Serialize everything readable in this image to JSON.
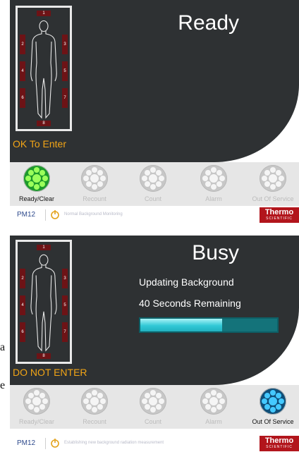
{
  "page_fragments": [
    "a",
    "e"
  ],
  "screens": [
    {
      "state_title": "Ready",
      "entry_status": "OK To Enter",
      "messages": [],
      "progress": null,
      "sensors": [
        "1",
        "2",
        "3",
        "4",
        "5",
        "6",
        "7",
        "8"
      ],
      "indicators": [
        {
          "label": "Ready/Clear",
          "active": true,
          "color": "#1d9a2c"
        },
        {
          "label": "Recount",
          "active": false
        },
        {
          "label": "Count",
          "active": false
        },
        {
          "label": "Alarm",
          "active": false
        },
        {
          "label": "Out Of Service",
          "active": false
        }
      ],
      "status_bar": {
        "device": "PM12",
        "message": "Normal Background Monitoring"
      },
      "brand": {
        "name": "Thermo",
        "sub": "SCIENTIFIC"
      }
    },
    {
      "state_title": "Busy",
      "entry_status": "DO NOT ENTER",
      "messages": [
        "Updating Background",
        "40 Seconds Remaining"
      ],
      "progress": 0.6,
      "sensors": [
        "1",
        "2",
        "3",
        "4",
        "5",
        "6",
        "7",
        "8"
      ],
      "indicators": [
        {
          "label": "Ready/Clear",
          "active": false
        },
        {
          "label": "Recount",
          "active": false
        },
        {
          "label": "Count",
          "active": false
        },
        {
          "label": "Alarm",
          "active": false
        },
        {
          "label": "Out Of Service",
          "active": true,
          "color": "#0f4f79"
        }
      ],
      "status_bar": {
        "device": "PM12",
        "message": "Establishing new background radiation measurement"
      },
      "brand": {
        "name": "Thermo",
        "sub": "SCIENTIFIC"
      }
    }
  ],
  "colors": {
    "panel": "#2e3133",
    "entry_status": "#f2a516",
    "sensor": "#6d1316",
    "progress": "#31c9d6",
    "brand": "#b2151c"
  }
}
